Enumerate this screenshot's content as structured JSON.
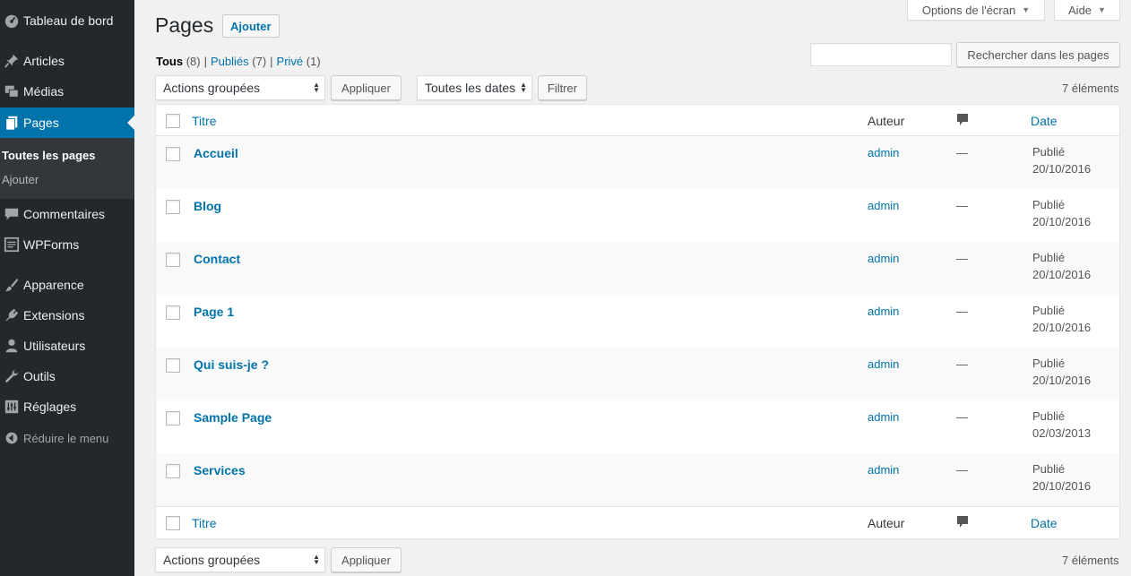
{
  "sidebar": {
    "items": [
      {
        "label": "Tableau de bord",
        "icon": "dashboard-icon"
      },
      {
        "label": "Articles",
        "icon": "pin-icon"
      },
      {
        "label": "Médias",
        "icon": "media-icon"
      },
      {
        "label": "Pages",
        "icon": "pages-icon"
      },
      {
        "label": "Commentaires",
        "icon": "comment-icon"
      },
      {
        "label": "WPForms",
        "icon": "forms-icon"
      },
      {
        "label": "Apparence",
        "icon": "brush-icon"
      },
      {
        "label": "Extensions",
        "icon": "plugin-icon"
      },
      {
        "label": "Utilisateurs",
        "icon": "user-icon"
      },
      {
        "label": "Outils",
        "icon": "wrench-icon"
      },
      {
        "label": "Réglages",
        "icon": "settings-icon"
      }
    ],
    "submenu": [
      {
        "label": "Toutes les pages"
      },
      {
        "label": "Ajouter"
      }
    ],
    "collapse_label": "Réduire le menu"
  },
  "screen_meta": {
    "options_label": "Options de l'écran",
    "help_label": "Aide"
  },
  "header": {
    "title": "Pages",
    "add_new_label": "Ajouter"
  },
  "views": {
    "all": {
      "label": "Tous",
      "count": "(8)"
    },
    "published": {
      "label": "Publiés",
      "count": "(7)"
    },
    "private": {
      "label": "Privé",
      "count": "(1)"
    },
    "separator": "|"
  },
  "search": {
    "value": "",
    "button_label": "Rechercher dans les pages"
  },
  "tablenav_top": {
    "bulk_actions": "Actions groupées",
    "apply_label": "Appliquer",
    "dates_filter": "Toutes les dates",
    "filter_label": "Filtrer",
    "items_count": "7 éléments"
  },
  "tablenav_bottom": {
    "bulk_actions": "Actions groupées",
    "apply_label": "Appliquer",
    "items_count": "7 éléments"
  },
  "table": {
    "columns": {
      "title": "Titre",
      "author": "Auteur",
      "comments_icon": "comment-bubble-icon",
      "date": "Date"
    },
    "rows": [
      {
        "title": "Accueil",
        "author": "admin",
        "comments": "—",
        "status": "Publié",
        "date": "20/10/2016"
      },
      {
        "title": "Blog",
        "author": "admin",
        "comments": "—",
        "status": "Publié",
        "date": "20/10/2016"
      },
      {
        "title": "Contact",
        "author": "admin",
        "comments": "—",
        "status": "Publié",
        "date": "20/10/2016"
      },
      {
        "title": "Page 1",
        "author": "admin",
        "comments": "—",
        "status": "Publié",
        "date": "20/10/2016"
      },
      {
        "title": "Qui suis-je ?",
        "author": "admin",
        "comments": "—",
        "status": "Publié",
        "date": "20/10/2016"
      },
      {
        "title": "Sample Page",
        "author": "admin",
        "comments": "—",
        "status": "Publié",
        "date": "02/03/2013"
      },
      {
        "title": "Services",
        "author": "admin",
        "comments": "—",
        "status": "Publié",
        "date": "20/10/2016"
      }
    ]
  },
  "colors": {
    "sidebar_bg": "#23282d",
    "submenu_bg": "#32373c",
    "accent": "#0073aa",
    "page_bg": "#f1f1f1"
  }
}
